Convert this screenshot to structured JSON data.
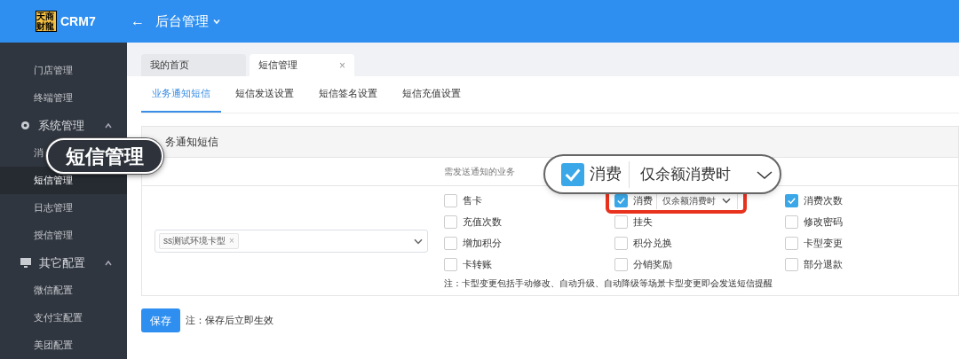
{
  "header": {
    "logo": "天商财龍",
    "app": "CRM7",
    "back": "←",
    "title": "后台管理"
  },
  "sidebar": {
    "items": [
      {
        "kind": "item",
        "label": "门店管理",
        "selected": false
      },
      {
        "kind": "item",
        "label": "终端管理",
        "selected": false
      },
      {
        "kind": "group",
        "label": "系统管理",
        "expanded": true
      },
      {
        "kind": "item",
        "label": "消",
        "selected": false
      },
      {
        "kind": "item",
        "label": "短信管理",
        "selected": true
      },
      {
        "kind": "item",
        "label": "日志管理",
        "selected": false
      },
      {
        "kind": "item",
        "label": "授信管理",
        "selected": false
      },
      {
        "kind": "group",
        "label": "其它配置",
        "expanded": true
      },
      {
        "kind": "item",
        "label": "微信配置",
        "selected": false
      },
      {
        "kind": "item",
        "label": "支付宝配置",
        "selected": false
      },
      {
        "kind": "item",
        "label": "美团配置",
        "selected": false
      }
    ]
  },
  "page_tabs": [
    {
      "label": "我的首页",
      "selected": false
    },
    {
      "label": "短信管理",
      "selected": true,
      "close": "×"
    }
  ],
  "sub_tabs": [
    {
      "label": "业务通知短信",
      "selected": true
    },
    {
      "label": "短信发送设置",
      "selected": false
    },
    {
      "label": "短信签名设置",
      "selected": false
    },
    {
      "label": "短信充值设置",
      "selected": false
    }
  ],
  "panel": {
    "title": "务通知短信",
    "table": {
      "columns": [
        "需发送通知的业务"
      ],
      "card_select": {
        "tags": [
          {
            "label": "ss测试环境卡型",
            "remove": "×"
          }
        ]
      },
      "options": [
        {
          "kind": "checkbox",
          "label": "售卡",
          "checked": false
        },
        {
          "kind": "checkbox-select",
          "label": "消费",
          "checked": true,
          "value": "仅余额消费时",
          "highlighted": true
        },
        {
          "kind": "checkbox",
          "label": "消费次数",
          "checked": true
        },
        {
          "kind": "checkbox",
          "label": "充值次数",
          "checked": false
        },
        {
          "kind": "checkbox",
          "label": "挂失",
          "checked": false
        },
        {
          "kind": "checkbox",
          "label": "修改密码",
          "checked": false
        },
        {
          "kind": "checkbox",
          "label": "增加积分",
          "checked": false
        },
        {
          "kind": "checkbox",
          "label": "积分兑换",
          "checked": false
        },
        {
          "kind": "checkbox",
          "label": "卡型变更",
          "checked": false
        },
        {
          "kind": "checkbox",
          "label": "卡转账",
          "checked": false
        },
        {
          "kind": "checkbox",
          "label": "分销奖励",
          "checked": false
        },
        {
          "kind": "checkbox",
          "label": "部分退款",
          "checked": false
        }
      ],
      "note": "注：卡型变更包括手动修改、自动升级、自动降级等场景卡型变更即会发送短信提醒"
    }
  },
  "footer": {
    "save": "保存",
    "note": "注：保存后立即生效"
  },
  "callouts": [
    {
      "kind": "label",
      "text": "短信管理"
    },
    {
      "kind": "zoom",
      "label": "消费",
      "checked": true,
      "value": "仅余额消费时"
    }
  ]
}
